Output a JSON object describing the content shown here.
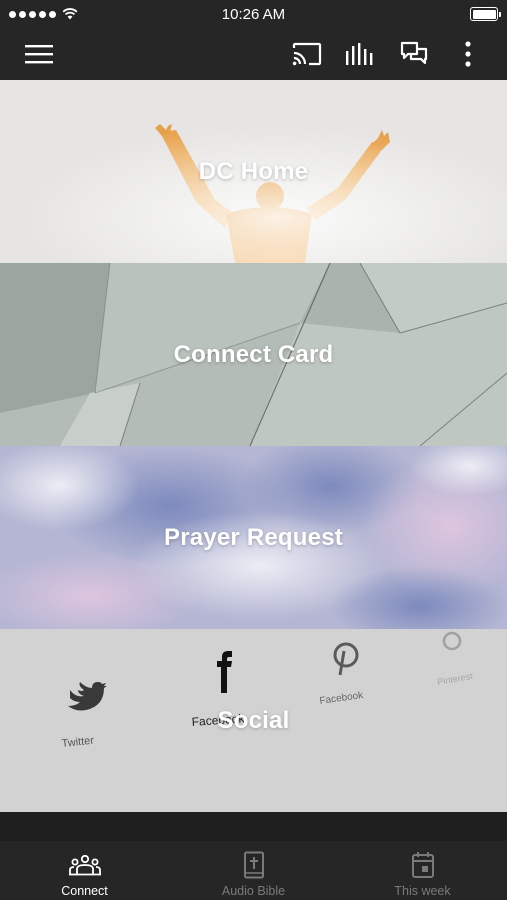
{
  "status_bar": {
    "time": "10:26 AM",
    "signal_icon": "signal-dots-icon",
    "wifi_icon": "wifi-icon",
    "battery_icon": "battery-icon",
    "battery_level": 1.0
  },
  "app_bar": {
    "icons": [
      "menu-icon",
      "cast-icon",
      "audio-bars-icon",
      "chat-icon",
      "more-vertical-icon"
    ]
  },
  "tiles": [
    {
      "title": "DC Home"
    },
    {
      "title": "Connect Card"
    },
    {
      "title": "Prayer Request"
    },
    {
      "title": "Social",
      "image_text": [
        "Twitter",
        "Facebook",
        "Facebook",
        "Pinterest"
      ]
    }
  ],
  "bottom_nav": {
    "items": [
      {
        "label": "Connect",
        "icon": "people-group-icon",
        "active": true
      },
      {
        "label": "Audio Bible",
        "icon": "bible-icon",
        "active": false
      },
      {
        "label": "This week",
        "icon": "calendar-icon",
        "active": false
      }
    ]
  },
  "colors": {
    "bar_background": "#262626",
    "active_label": "#ffffff",
    "inactive_label": "#7a7a7a"
  }
}
